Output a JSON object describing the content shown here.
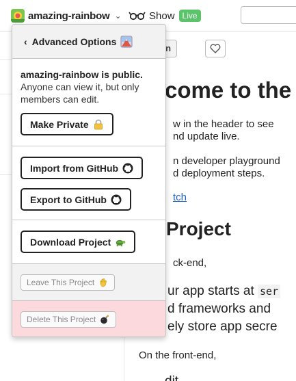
{
  "header": {
    "project_name": "amazing-rainbow",
    "show_label": "Show",
    "live_badge": "Live"
  },
  "content": {
    "mini_button_label": "wn",
    "heading1": "come to the",
    "para1_line1": "w in the header to see",
    "para1_line2": "nd update live.",
    "para2_line1": "n developer playground",
    "para2_line2": "d deployment steps.",
    "link_text": "tch",
    "heading2": "Project",
    "backend_label": "ck-end,",
    "big1_prefix": "ur app starts at ",
    "big1_code": "ser",
    "big2": "d frameworks and",
    "big3": "ely store app secre",
    "frontend_label": "On the front-end,",
    "bottom_partial": "dit"
  },
  "popover": {
    "title": "Advanced Options",
    "info_title": "amazing-rainbow is public.",
    "info_desc": "Anyone can view it, but only members can edit.",
    "make_private": "Make Private",
    "import_github": "Import from GitHub",
    "export_github": "Export to GitHub",
    "download_project": "Download Project",
    "leave_project": "Leave This Project",
    "delete_project": "Delete This Project"
  },
  "icons": {
    "back": "chevron-left-icon",
    "advanced": "mountain-picture-icon",
    "lock": "lock-icon",
    "github": "github-icon",
    "turtle": "turtle-icon",
    "wave": "waving-hand-icon",
    "bomb": "bomb-icon",
    "glasses": "sunglasses-icon"
  },
  "colors": {
    "live_badge": "#5bc36a",
    "danger_bg": "#fbd9dd",
    "link": "#1d63d0"
  }
}
